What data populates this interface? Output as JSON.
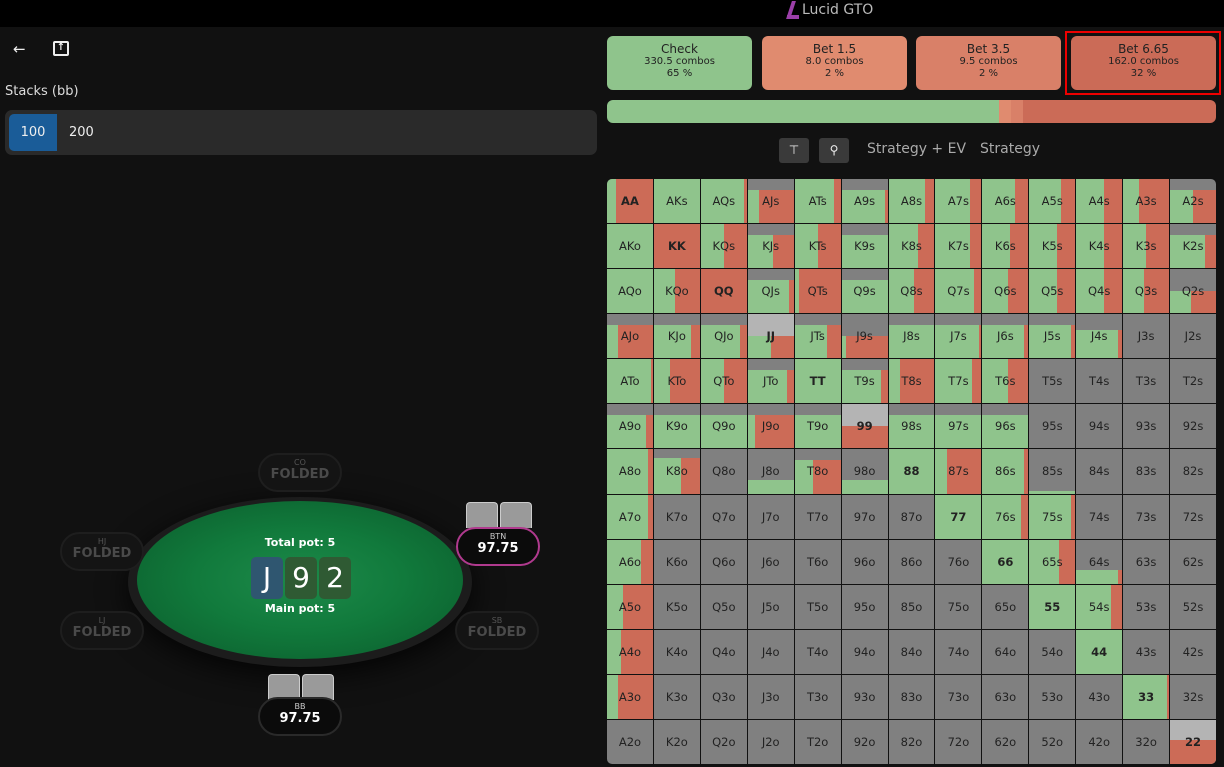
{
  "header": {
    "title": "Lucid GTO",
    "logo_icon": "lucid-logo"
  },
  "nav": {
    "back_icon": "arrow-left-icon",
    "share_icon": "share-icon"
  },
  "stacks": {
    "label": "Stacks (bb)",
    "options": [
      "100",
      "200"
    ],
    "selected": "100"
  },
  "table": {
    "total_pot": "Total pot: 5",
    "main_pot": "Main pot: 5",
    "board": [
      "J",
      "9",
      "2"
    ],
    "board_colors": [
      "#2f5670",
      "#2f5a33",
      "#2f5a33"
    ],
    "seats": {
      "co": {
        "pos": "CO",
        "status": "FOLDED"
      },
      "hj": {
        "pos": "HJ",
        "status": "FOLDED"
      },
      "lj": {
        "pos": "LJ",
        "status": "FOLDED"
      },
      "sb": {
        "pos": "SB",
        "status": "FOLDED"
      },
      "btn": {
        "pos": "BTN",
        "stack": "97.75"
      },
      "bb": {
        "pos": "BB",
        "stack": "97.75"
      }
    }
  },
  "actions": [
    {
      "label": "Check",
      "combos": "330.5 combos",
      "pct": "65 %",
      "color": "#8fc48c",
      "value": 65
    },
    {
      "label": "Bet 1.5",
      "combos": "8.0 combos",
      "pct": "2 %",
      "color": "#e08b6f",
      "value": 2
    },
    {
      "label": "Bet 3.5",
      "combos": "9.5 combos",
      "pct": "2 %",
      "color": "#d98068",
      "value": 2
    },
    {
      "label": "Bet 6.65",
      "combos": "162.0 combos",
      "pct": "32 %",
      "color": "#cb6b57",
      "value": 32,
      "highlighted": true
    }
  ],
  "toolbar": {
    "align_icon": "align-top-icon",
    "zoom_icon": "magnifier-icon",
    "views": [
      "Strategy + EV",
      "Strategy"
    ]
  },
  "matrix": {
    "legend": "each cell: [in-range weight, check fraction]; remainder is bet",
    "labels": [
      [
        "AA",
        "AKs",
        "AQs",
        "AJs",
        "ATs",
        "A9s",
        "A8s",
        "A7s",
        "A6s",
        "A5s",
        "A4s",
        "A3s",
        "A2s"
      ],
      [
        "AKo",
        "KK",
        "KQs",
        "KJs",
        "KTs",
        "K9s",
        "K8s",
        "K7s",
        "K6s",
        "K5s",
        "K4s",
        "K3s",
        "K2s"
      ],
      [
        "AQo",
        "KQo",
        "QQ",
        "QJs",
        "QTs",
        "Q9s",
        "Q8s",
        "Q7s",
        "Q6s",
        "Q5s",
        "Q4s",
        "Q3s",
        "Q2s"
      ],
      [
        "AJo",
        "KJo",
        "QJo",
        "JJ",
        "JTs",
        "J9s",
        "J8s",
        "J7s",
        "J6s",
        "J5s",
        "J4s",
        "J3s",
        "J2s"
      ],
      [
        "ATo",
        "KTo",
        "QTo",
        "JTo",
        "TT",
        "T9s",
        "T8s",
        "T7s",
        "T6s",
        "T5s",
        "T4s",
        "T3s",
        "T2s"
      ],
      [
        "A9o",
        "K9o",
        "Q9o",
        "J9o",
        "T9o",
        "99",
        "98s",
        "97s",
        "96s",
        "95s",
        "94s",
        "93s",
        "92s"
      ],
      [
        "A8o",
        "K8o",
        "Q8o",
        "J8o",
        "T8o",
        "98o",
        "88",
        "87s",
        "86s",
        "85s",
        "84s",
        "83s",
        "82s"
      ],
      [
        "A7o",
        "K7o",
        "Q7o",
        "J7o",
        "T7o",
        "97o",
        "87o",
        "77",
        "76s",
        "75s",
        "74s",
        "73s",
        "72s"
      ],
      [
        "A6o",
        "K6o",
        "Q6o",
        "J6o",
        "T6o",
        "96o",
        "86o",
        "76o",
        "66",
        "65s",
        "64s",
        "63s",
        "62s"
      ],
      [
        "A5o",
        "K5o",
        "Q5o",
        "J5o",
        "T5o",
        "95o",
        "85o",
        "75o",
        "65o",
        "55",
        "54s",
        "53s",
        "52s"
      ],
      [
        "A4o",
        "K4o",
        "Q4o",
        "J4o",
        "T4o",
        "94o",
        "84o",
        "74o",
        "64o",
        "54o",
        "44",
        "43s",
        "42s"
      ],
      [
        "A3o",
        "K3o",
        "Q3o",
        "J3o",
        "T3o",
        "93o",
        "83o",
        "73o",
        "63o",
        "53o",
        "43o",
        "33",
        "32s"
      ],
      [
        "A2o",
        "K2o",
        "Q2o",
        "J2o",
        "T2o",
        "92o",
        "82o",
        "72o",
        "62o",
        "52o",
        "42o",
        "32o",
        "22"
      ]
    ],
    "values": [
      [
        [
          1,
          0.2
        ],
        [
          1,
          1
        ],
        [
          1,
          0.95
        ],
        [
          0.75,
          0.25
        ],
        [
          1,
          0.85
        ],
        [
          0.75,
          0.95
        ],
        [
          1,
          0.8
        ],
        [
          1,
          0.75
        ],
        [
          1,
          0.7
        ],
        [
          1,
          0.7
        ],
        [
          1,
          0.6
        ],
        [
          1,
          0.35
        ],
        [
          0.75,
          0.5
        ]
      ],
      [
        [
          1,
          1
        ],
        [
          1,
          0
        ],
        [
          1,
          0.5
        ],
        [
          0.75,
          0.55
        ],
        [
          1,
          0.5
        ],
        [
          0.75,
          1
        ],
        [
          1,
          0.65
        ],
        [
          1,
          0.75
        ],
        [
          1,
          0.6
        ],
        [
          1,
          0.6
        ],
        [
          1,
          0.6
        ],
        [
          1,
          0.5
        ],
        [
          0.75,
          0.75
        ]
      ],
      [
        [
          1,
          1
        ],
        [
          1,
          0.45
        ],
        [
          1,
          0
        ],
        [
          0.75,
          0.9
        ],
        [
          1,
          0.1
        ],
        [
          0.75,
          1
        ],
        [
          1,
          0.55
        ],
        [
          1,
          0.85
        ],
        [
          1,
          0.55
        ],
        [
          1,
          0.6
        ],
        [
          1,
          0.6
        ],
        [
          1,
          0.45
        ],
        [
          0.5,
          0.45
        ]
      ],
      [
        [
          0.75,
          0.25
        ],
        [
          0.75,
          0.8
        ],
        [
          0.75,
          0.85
        ],
        [
          0.5,
          0.5
        ],
        [
          0.75,
          0.7
        ],
        [
          0.5,
          0.1
        ],
        [
          0.75,
          1
        ],
        [
          0.75,
          0.95
        ],
        [
          0.75,
          0.9
        ],
        [
          0.75,
          0.9
        ],
        [
          0.65,
          0.9
        ],
        [
          0,
          0
        ],
        [
          0,
          0
        ]
      ],
      [
        [
          1,
          0.95
        ],
        [
          1,
          0.35
        ],
        [
          1,
          0.5
        ],
        [
          0.75,
          0.85
        ],
        [
          1,
          1
        ],
        [
          0.75,
          0.85
        ],
        [
          1,
          0.25
        ],
        [
          1,
          0.8
        ],
        [
          1,
          0.55
        ],
        [
          0,
          0
        ],
        [
          0,
          0
        ],
        [
          0,
          0
        ],
        [
          0,
          0
        ]
      ],
      [
        [
          0.75,
          0.85
        ],
        [
          0.75,
          1
        ],
        [
          0.75,
          1
        ],
        [
          0.75,
          0.15
        ],
        [
          0.75,
          1
        ],
        [
          0.5,
          0
        ],
        [
          0.75,
          1
        ],
        [
          0.75,
          1
        ],
        [
          0.75,
          1
        ],
        [
          0,
          0
        ],
        [
          0,
          0
        ],
        [
          0,
          0
        ],
        [
          0,
          0
        ]
      ],
      [
        [
          1,
          0.9
        ],
        [
          0.8,
          0.6
        ],
        [
          0,
          0
        ],
        [
          0.3,
          1
        ],
        [
          0.75,
          0.4
        ],
        [
          0.3,
          1
        ],
        [
          1,
          1
        ],
        [
          1,
          0.25
        ],
        [
          1,
          0.9
        ],
        [
          0.05,
          1
        ],
        [
          0,
          0
        ],
        [
          0,
          0
        ],
        [
          0,
          0
        ]
      ],
      [
        [
          1,
          0.9
        ],
        [
          0,
          0
        ],
        [
          0,
          0
        ],
        [
          0,
          0
        ],
        [
          0,
          0
        ],
        [
          0,
          0
        ],
        [
          0,
          0
        ],
        [
          1,
          1
        ],
        [
          1,
          0.85
        ],
        [
          1,
          0.9
        ],
        [
          0,
          0
        ],
        [
          0,
          0
        ],
        [
          0,
          0
        ]
      ],
      [
        [
          1,
          0.75
        ],
        [
          0,
          0
        ],
        [
          0,
          0
        ],
        [
          0,
          0
        ],
        [
          0,
          0
        ],
        [
          0,
          0
        ],
        [
          0,
          0
        ],
        [
          0,
          0
        ],
        [
          1,
          1
        ],
        [
          1,
          0.65
        ],
        [
          0.3,
          0.9
        ],
        [
          0,
          0
        ],
        [
          0,
          0
        ]
      ],
      [
        [
          1,
          0.35
        ],
        [
          0,
          0
        ],
        [
          0,
          0
        ],
        [
          0,
          0
        ],
        [
          0,
          0
        ],
        [
          0,
          0
        ],
        [
          0,
          0
        ],
        [
          0,
          0
        ],
        [
          0,
          0
        ],
        [
          1,
          1
        ],
        [
          1,
          0.75
        ],
        [
          0,
          0
        ],
        [
          0,
          0
        ]
      ],
      [
        [
          1,
          0.3
        ],
        [
          0,
          0
        ],
        [
          0,
          0
        ],
        [
          0,
          0
        ],
        [
          0,
          0
        ],
        [
          0,
          0
        ],
        [
          0,
          0
        ],
        [
          0,
          0
        ],
        [
          0,
          0
        ],
        [
          0,
          0
        ],
        [
          1,
          1
        ],
        [
          0,
          0
        ],
        [
          0,
          0
        ]
      ],
      [
        [
          1,
          0.25
        ],
        [
          0,
          0
        ],
        [
          0,
          0
        ],
        [
          0,
          0
        ],
        [
          0,
          0
        ],
        [
          0,
          0
        ],
        [
          0,
          0
        ],
        [
          0,
          0
        ],
        [
          0,
          0
        ],
        [
          0,
          0
        ],
        [
          0,
          0
        ],
        [
          1,
          0.95
        ],
        [
          0,
          0
        ]
      ],
      [
        [
          0,
          0
        ],
        [
          0,
          0
        ],
        [
          0,
          0
        ],
        [
          0,
          0
        ],
        [
          0,
          0
        ],
        [
          0,
          0
        ],
        [
          0,
          0
        ],
        [
          0,
          0
        ],
        [
          0,
          0
        ],
        [
          0,
          0
        ],
        [
          0,
          0
        ],
        [
          0,
          0
        ],
        [
          0.55,
          0
        ]
      ]
    ]
  }
}
